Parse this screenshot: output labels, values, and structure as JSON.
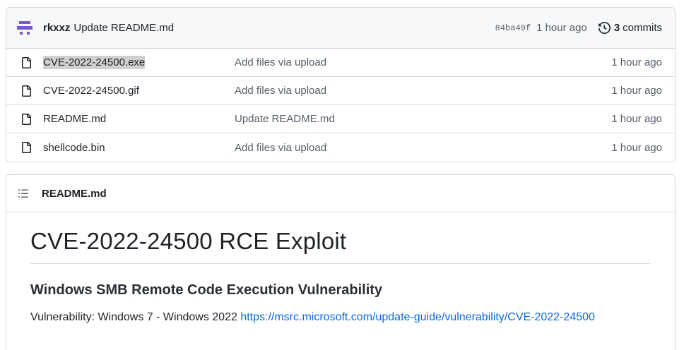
{
  "commit": {
    "author": "rkxxz",
    "message": "Update README.md",
    "sha": "84ba49f",
    "time": "1 hour ago",
    "commits_count": "3",
    "commits_label": "commits"
  },
  "files": [
    {
      "name": "CVE-2022-24500.exe",
      "message": "Add files via upload",
      "time": "1 hour ago"
    },
    {
      "name": "CVE-2022-24500.gif",
      "message": "Add files via upload",
      "time": "1 hour ago"
    },
    {
      "name": "README.md",
      "message": "Update README.md",
      "time": "1 hour ago"
    },
    {
      "name": "shellcode.bin",
      "message": "Add files via upload",
      "time": "1 hour ago"
    }
  ],
  "readme": {
    "filename": "README.md",
    "h1": "CVE-2022-24500 RCE Exploit",
    "h3": "Windows SMB Remote Code Execution Vulnerability",
    "text": "Vulnerability: Windows 7 - Windows 2022",
    "link": "https://msrc.microsoft.com/update-guide/vulnerability/CVE-2022-24500"
  },
  "icons": {
    "avatar": "identicon-avatar",
    "history": "history-icon",
    "file": "file-icon",
    "toc": "list-unordered-icon"
  },
  "colors": {
    "link": "#0969da",
    "muted": "#57606a",
    "avatar": "#6f42c1"
  }
}
